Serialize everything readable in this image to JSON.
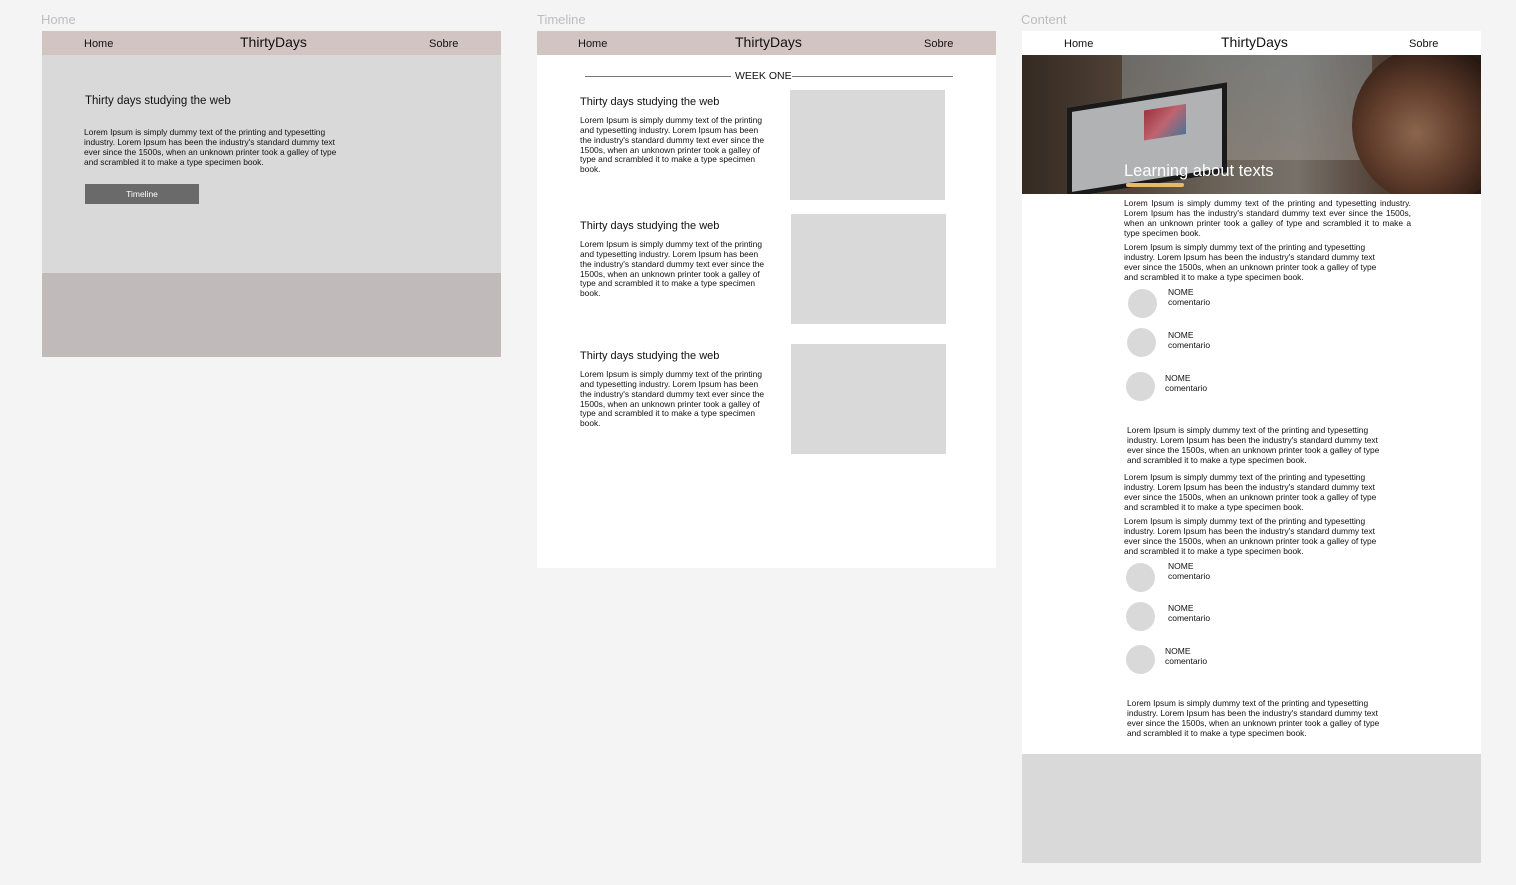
{
  "frames": {
    "home": {
      "label": "Home",
      "nav": {
        "home": "Home",
        "brand": "ThirtyDays",
        "sobre": "Sobre"
      },
      "title": "Thirty days studying the web",
      "text": "Lorem Ipsum is simply dummy text of the printing and typesetting industry. Lorem Ipsum has been the industry's standard dummy text ever since the 1500s, when an unknown printer took a galley of type and scrambled it to make a type specimen book.",
      "button": "Timeline"
    },
    "timeline": {
      "label": "Timeline",
      "nav": {
        "home": "Home",
        "brand": "ThirtyDays",
        "sobre": "Sobre"
      },
      "week": "WEEK ONE",
      "items": [
        {
          "title": "Thirty days studying the web",
          "text": "Lorem Ipsum is simply dummy text of the printing and typesetting industry. Lorem Ipsum has been the industry's standard dummy text ever since the 1500s, when an unknown printer took a galley of type and scrambled it to make a type specimen book."
        },
        {
          "title": "Thirty days studying the web",
          "text": "Lorem Ipsum is simply dummy text of the printing and typesetting industry. Lorem Ipsum has been the industry's standard dummy text ever since the 1500s, when an unknown printer took a galley of type and scrambled it to make a type specimen book."
        },
        {
          "title": "Thirty days studying the web",
          "text": "Lorem Ipsum is simply dummy text of the printing and typesetting industry. Lorem Ipsum has been the industry's standard dummy text ever since the 1500s, when an unknown printer took a galley of type and scrambled it to make a type specimen book."
        }
      ]
    },
    "content": {
      "label": "Content",
      "nav": {
        "home": "Home",
        "brand": "ThirtyDays",
        "sobre": "Sobre"
      },
      "hero_title": "Learning about texts",
      "paragraphs": [
        "Lorem Ipsum is simply dummy text of the printing and typesetting industry. Lorem Ipsum has the industry's standard dummy text ever since the 1500s, when an unknown printer took a galley of type and scrambled it to make a type specimen book.",
        "Lorem Ipsum is simply dummy text of the printing and typesetting industry. Lorem Ipsum has been the industry's standard dummy text ever since the 1500s, when an unknown printer took a galley of type and scrambled it to make a type specimen book.",
        "Lorem Ipsum is simply dummy text of the printing and typesetting industry. Lorem Ipsum has been the industry's standard dummy text ever since the 1500s, when an unknown printer took a galley of type and scrambled it to make a type specimen book.",
        "Lorem Ipsum is simply dummy text of the printing and typesetting industry. Lorem Ipsum has been the industry's standard dummy text ever since the 1500s, when an unknown printer took a galley of type and scrambled it to make a type specimen book.",
        "Lorem Ipsum is simply dummy text of the printing and typesetting industry. Lorem Ipsum has been the industry's standard dummy text ever since the 1500s, when an unknown printer took a galley of type and scrambled it to make a type specimen book.",
        "Lorem Ipsum is simply dummy text of the printing and typesetting industry. Lorem Ipsum has been the industry's standard dummy text ever since the 1500s, when an unknown printer took a galley of type and scrambled it to make a type specimen book."
      ],
      "comments": [
        {
          "name": "NOME",
          "text": "comentario"
        },
        {
          "name": "NOME",
          "text": "comentario"
        },
        {
          "name": "NOME",
          "text": "comentario"
        },
        {
          "name": "NOME",
          "text": "comentario"
        },
        {
          "name": "NOME",
          "text": "comentario"
        },
        {
          "name": "NOME",
          "text": "comentario"
        }
      ]
    }
  },
  "colors": {
    "canvas": "#f4f4f4",
    "nav_bg": "#d3c4c4",
    "home_bg": "#d9d9d9",
    "home_footer": "#c0bbba",
    "button": "#6a6a6a",
    "placeholder": "#d9d9d9",
    "hero_underline": "#e7b86e"
  }
}
